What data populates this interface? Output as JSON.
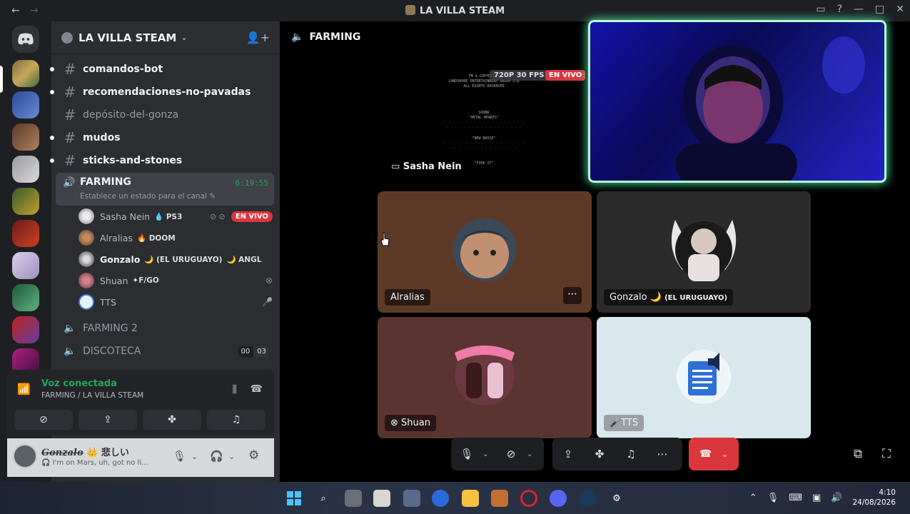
{
  "window": {
    "title": "LA VILLA STEAM",
    "back_icon": "←",
    "forward_icon": "→"
  },
  "server": {
    "name": "LA VILLA STEAM"
  },
  "text_channels": [
    {
      "label": "comandos-bot",
      "unread": true
    },
    {
      "label": "recomendaciones-no-pavadas",
      "unread": true
    },
    {
      "label": "depósito-del-gonza",
      "unread": false
    },
    {
      "label": "mudos",
      "unread": true
    },
    {
      "label": "sticks-and-stones",
      "unread": true
    }
  ],
  "active_voice": {
    "name": "FARMING",
    "timer": "6:19:55",
    "status_placeholder": "Establece un estado para el canal"
  },
  "members": [
    {
      "name": "Sasha Nein",
      "tag": "PS3",
      "tag_icon": "💧",
      "badge": "EN VIVO"
    },
    {
      "name": "Alralias",
      "tag": "DOOM",
      "tag_icon": "🔥"
    },
    {
      "name": "Gonzalo",
      "tag": "(EL URUGUAYO)",
      "tag_icon": "🌙",
      "tag2": "ANGL",
      "tag2_icon": "🌙"
    },
    {
      "name": "Shuan",
      "tag": "F/GO",
      "tag_icon": "✦"
    },
    {
      "name": "TTS"
    }
  ],
  "other_voice": [
    {
      "name": "FARMING 2"
    },
    {
      "name": "DISCOTECA",
      "count_a": "00",
      "count_b": "03"
    }
  ],
  "voice_panel": {
    "title": "Voz conectada",
    "subtitle": "FARMING / LA VILLA STEAM"
  },
  "user": {
    "display_name": "Gonzalo",
    "name_suffix": "👑 悲しい",
    "custom_status": "🎧 I'm on Mars, uh, got no li..."
  },
  "main": {
    "channel": "FARMING",
    "stream": {
      "quality": "720P 30 FPS",
      "live": "EN VIVO",
      "streamer": "Sasha Nein",
      "text_lines": [
        "FM & COPYRIGHT",
        "LANDSHORE ENTERTAINMENT GROUP LTD",
        "ALL RIGHTS RESERVED",
        "",
        "SOUND",
        "\"METAL HEARTS\"",
        "",
        "\"NEW NOISE\"",
        "\"FIRE IT\""
      ]
    },
    "tiles": [
      {
        "name": "Alralias",
        "bg": "#5d3a28"
      },
      {
        "name": "Gonzalo",
        "extra": "(EL URUGUAYO)",
        "bg": "#2b2b2b"
      },
      {
        "name": "Shuan",
        "bg": "#5a3430"
      },
      {
        "name": "TTS",
        "bg": "#d8e8ec"
      }
    ]
  },
  "taskbar": {
    "time": "4:10",
    "date": "24/08/2026"
  },
  "colors": {
    "accent_green": "#23a55a",
    "live_red": "#da373c",
    "camera_glow": "#52f5b0"
  }
}
